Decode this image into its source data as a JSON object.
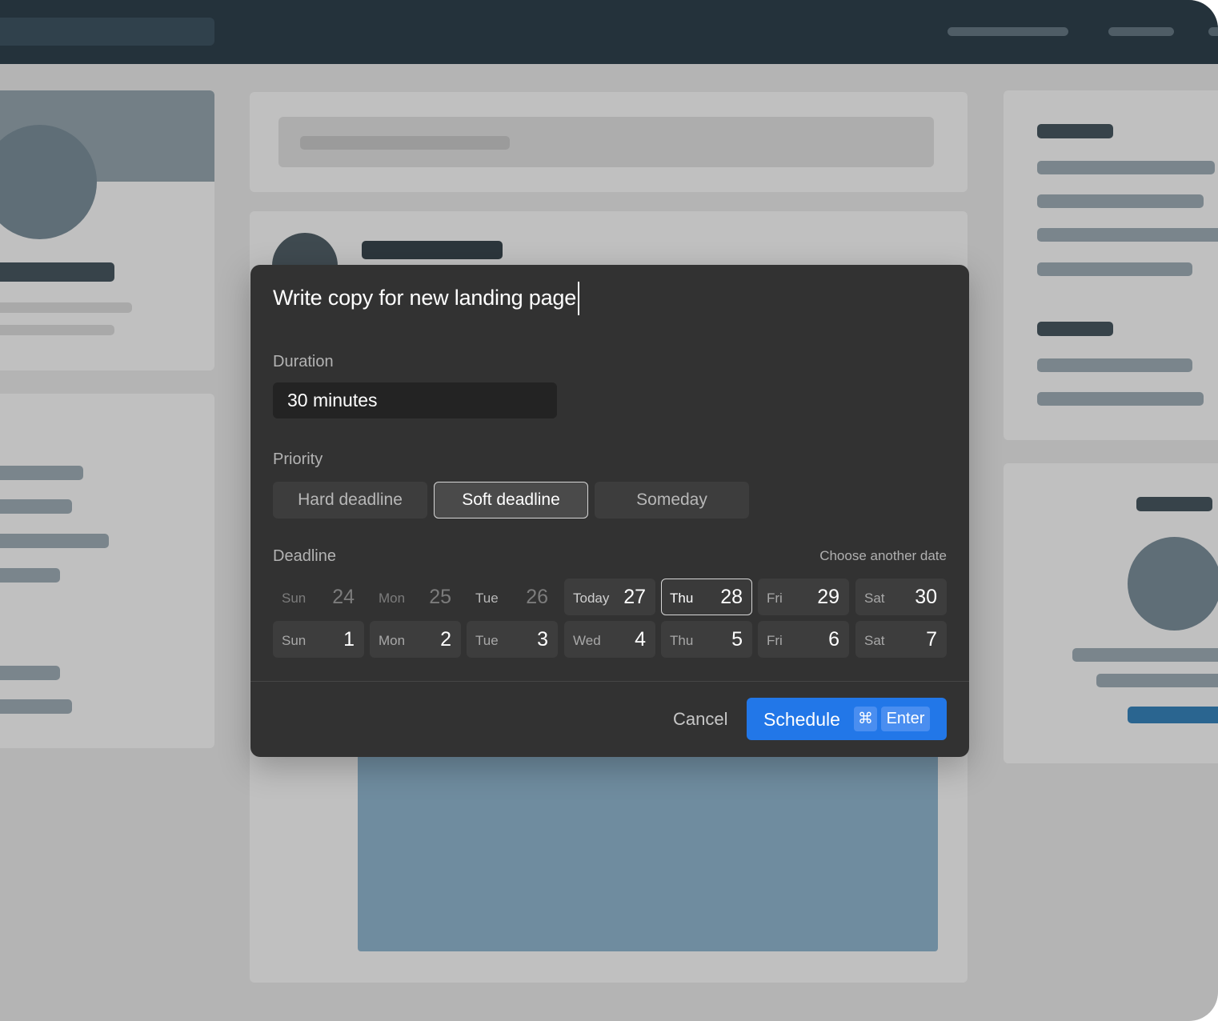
{
  "task": {
    "title": "Write copy for new landing page"
  },
  "duration": {
    "label": "Duration",
    "value": "30 minutes"
  },
  "priority": {
    "label": "Priority",
    "options": [
      "Hard deadline",
      "Soft deadline",
      "Someday"
    ],
    "selected": "Soft deadline"
  },
  "deadline": {
    "label": "Deadline",
    "choose_another": "Choose another date",
    "week1": [
      {
        "day": "Sun",
        "num": "24",
        "state": "past"
      },
      {
        "day": "Mon",
        "num": "25",
        "state": "past"
      },
      {
        "day": "Tue",
        "num": "26",
        "state": "past"
      },
      {
        "day": "Today",
        "num": "27",
        "state": "today"
      },
      {
        "day": "Thu",
        "num": "28",
        "state": "selected"
      },
      {
        "day": "Fri",
        "num": "29",
        "state": "normal"
      },
      {
        "day": "Sat",
        "num": "30",
        "state": "normal"
      }
    ],
    "week2": [
      {
        "day": "Sun",
        "num": "1",
        "state": "normal"
      },
      {
        "day": "Mon",
        "num": "2",
        "state": "normal"
      },
      {
        "day": "Tue",
        "num": "3",
        "state": "normal"
      },
      {
        "day": "Wed",
        "num": "4",
        "state": "normal"
      },
      {
        "day": "Thu",
        "num": "5",
        "state": "normal"
      },
      {
        "day": "Fri",
        "num": "6",
        "state": "normal"
      },
      {
        "day": "Sat",
        "num": "7",
        "state": "normal"
      }
    ]
  },
  "footer": {
    "cancel_label": "Cancel",
    "schedule_label": "Schedule",
    "shortcut_modifier": "⌘",
    "shortcut_key": "Enter"
  },
  "colors": {
    "primary_button": "#2277e8",
    "modal_background": "#323232",
    "topbar": "#24323b"
  }
}
